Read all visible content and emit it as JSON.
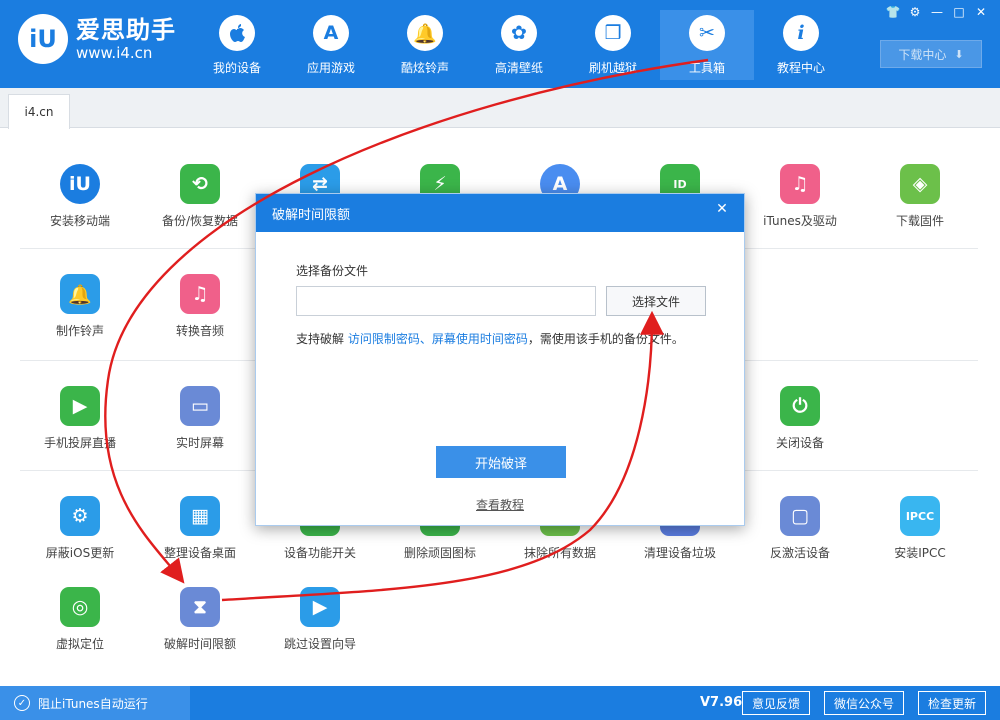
{
  "header": {
    "logo_mark": "iU",
    "logo_title": "爱思助手",
    "logo_url": "www.i4.cn",
    "nav": [
      {
        "label": "我的设备",
        "icon": ""
      },
      {
        "label": "应用游戏",
        "icon": "A"
      },
      {
        "label": "酷炫铃声",
        "icon": "🔔"
      },
      {
        "label": "高清壁纸",
        "icon": "✿"
      },
      {
        "label": "刷机越狱",
        "icon": "❒"
      },
      {
        "label": "工具箱",
        "icon": "✂"
      },
      {
        "label": "教程中心",
        "icon": "i"
      }
    ],
    "active_nav": "工具箱",
    "window_controls": [
      "👕",
      "⚙",
      "—",
      "□",
      "✕"
    ],
    "download_label": "下载中心",
    "download_icon": "⬇"
  },
  "tabs": [
    {
      "label": "i4.cn"
    }
  ],
  "tools": {
    "row1": [
      {
        "label": "安装移动端",
        "icon": "iU",
        "color": "#1b7de0"
      },
      {
        "label": "备份/恢复数据",
        "icon": "⟲",
        "color": "#3bb54a"
      },
      {
        "label": "",
        "icon": "⇄",
        "color": "#2b9ce8"
      },
      {
        "label": "",
        "icon": "⚡",
        "color": "#3bb54a"
      },
      {
        "label": "",
        "icon": "A",
        "color": "#4a8df0"
      },
      {
        "label": "",
        "icon": "ID",
        "color": "#3bb54a"
      },
      {
        "label": "iTunes及驱动",
        "icon": "♫",
        "color": "#f0608a"
      },
      {
        "label": "下载固件",
        "icon": "◈",
        "color": "#6cc04a"
      }
    ],
    "row2": [
      {
        "label": "制作铃声",
        "icon": "🔔",
        "color": "#2b9ce8"
      },
      {
        "label": "转换音频",
        "icon": "♫",
        "color": "#f0608a"
      }
    ],
    "row3": [
      {
        "label": "手机投屏直播",
        "icon": "▶",
        "color": "#3bb54a"
      },
      {
        "label": "实时屏幕",
        "icon": "▭",
        "color": "#6a8ad6"
      },
      {
        "label": "关闭设备",
        "icon": "⏻",
        "color": "#3bb54a"
      }
    ],
    "row4": [
      {
        "label": "屏蔽iOS更新",
        "icon": "⚙",
        "color": "#2b9ce8"
      },
      {
        "label": "整理设备桌面",
        "icon": "▦",
        "color": "#2b9ce8"
      },
      {
        "label": "设备功能开关",
        "icon": "◐",
        "color": "#3bb54a"
      },
      {
        "label": "删除顽固图标",
        "icon": "◉",
        "color": "#3bb54a"
      },
      {
        "label": "抹除所有数据",
        "icon": "▤",
        "color": "#6cc04a"
      },
      {
        "label": "清理设备垃圾",
        "icon": "◆",
        "color": "#5a7de0"
      },
      {
        "label": "反激活设备",
        "icon": "▢",
        "color": "#6a8ad6"
      },
      {
        "label": "安装IPCC",
        "icon": "IPCC",
        "color": "#39b6f0"
      }
    ],
    "row5": [
      {
        "label": "虚拟定位",
        "icon": "◎",
        "color": "#3bb54a"
      },
      {
        "label": "破解时间限额",
        "icon": "⧗",
        "color": "#6a8ad6"
      },
      {
        "label": "跳过设置向导",
        "icon": "▶",
        "color": "#2b9ce8"
      }
    ]
  },
  "dialog": {
    "title": "破解时间限额",
    "close_icon": "✕",
    "file_label": "选择备份文件",
    "file_value": "",
    "choose_button": "选择文件",
    "hint_prefix": "支持破解 ",
    "hint_link": "访问限制密码、屏幕使用时间密码",
    "hint_suffix": "，需使用该手机的备份文件。",
    "start_button": "开始破译",
    "tutorial_link": "查看教程"
  },
  "bottom": {
    "check_icon": "✓",
    "itunes_label": "阻止iTunes自动运行",
    "version": "V7.96",
    "feedback": "意见反馈",
    "wechat": "微信公众号",
    "update": "检查更新"
  },
  "colors": {
    "brand": "#1b7de0",
    "annotation": "#e01e1e"
  }
}
